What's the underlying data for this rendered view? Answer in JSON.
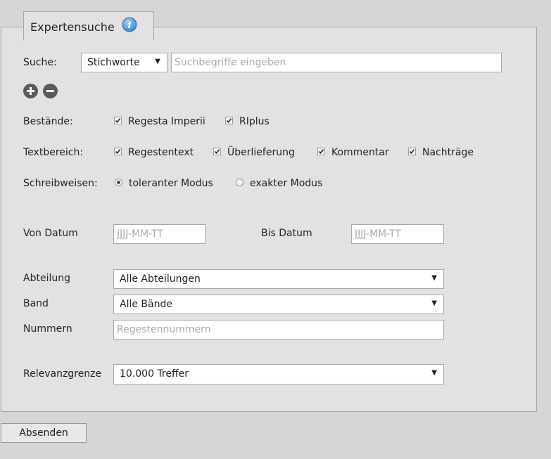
{
  "panel": {
    "title": "Expertensuche"
  },
  "search": {
    "label": "Suche:",
    "type_selected": "Stichworte",
    "placeholder": "Suchbegriffe eingeben"
  },
  "bestaende": {
    "label": "Bestände:",
    "options": [
      "Regesta Imperii",
      "RIplus"
    ]
  },
  "textbereich": {
    "label": "Textbereich:",
    "options": [
      "Regestentext",
      "Überlieferung",
      "Kommentar",
      "Nachträge"
    ]
  },
  "schreibweisen": {
    "label": "Schreibweisen:",
    "options": [
      "toleranter Modus",
      "exakter Modus"
    ]
  },
  "dates": {
    "from_label": "Von Datum",
    "from_placeholder": "JJJJ-MM-TT",
    "to_label": "Bis Datum",
    "to_placeholder": "JJJJ-MM-TT"
  },
  "abteilung": {
    "label": "Abteilung",
    "selected": "Alle Abteilungen"
  },
  "band": {
    "label": "Band",
    "selected": "Alle Bände"
  },
  "nummern": {
    "label": "Nummern",
    "placeholder": "Regestennummern"
  },
  "relevanz": {
    "label": "Relevanzgrenze",
    "selected": "10.000 Treffer"
  },
  "submit_label": "Absenden"
}
